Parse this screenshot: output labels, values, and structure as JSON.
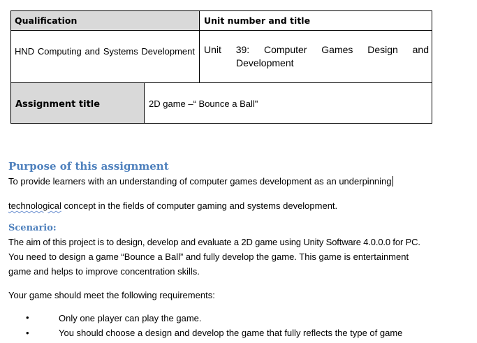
{
  "table": {
    "qualification_header": "Qualification",
    "unit_header": "Unit number and title",
    "qualification_value": "HND Computing and Systems Development",
    "unit_value": "Unit 39: Computer Games Design and Development",
    "assignment_label": "Assignment title",
    "assignment_value": "2D game –“ Bounce a Ball\""
  },
  "purpose": {
    "heading": "Purpose of this assignment",
    "line1": "To provide learners with an understanding of computer games development as an underpinning",
    "line2_misspelled": "technological",
    "line2_rest": " concept in the fields of computer gaming and systems development."
  },
  "scenario": {
    "heading": "Scenario:",
    "lines": [
      "The aim of this project is to design, develop and evaluate a 2D game using Unity Software 4.0.0.0 for PC.",
      "You need to design a game “Bounce a Ball” and fully develop the game. This game is entertainment",
      "game and helps to improve concentration skills."
    ],
    "requirements_intro": "Your game should meet the following requirements:",
    "bullets": [
      "Only one player can play the game.",
      "You should choose a design and develop the game that fully reflects the type of game"
    ]
  },
  "colors": {
    "heading": "#4f81bd",
    "grey_cell": "#d9d9d9"
  }
}
